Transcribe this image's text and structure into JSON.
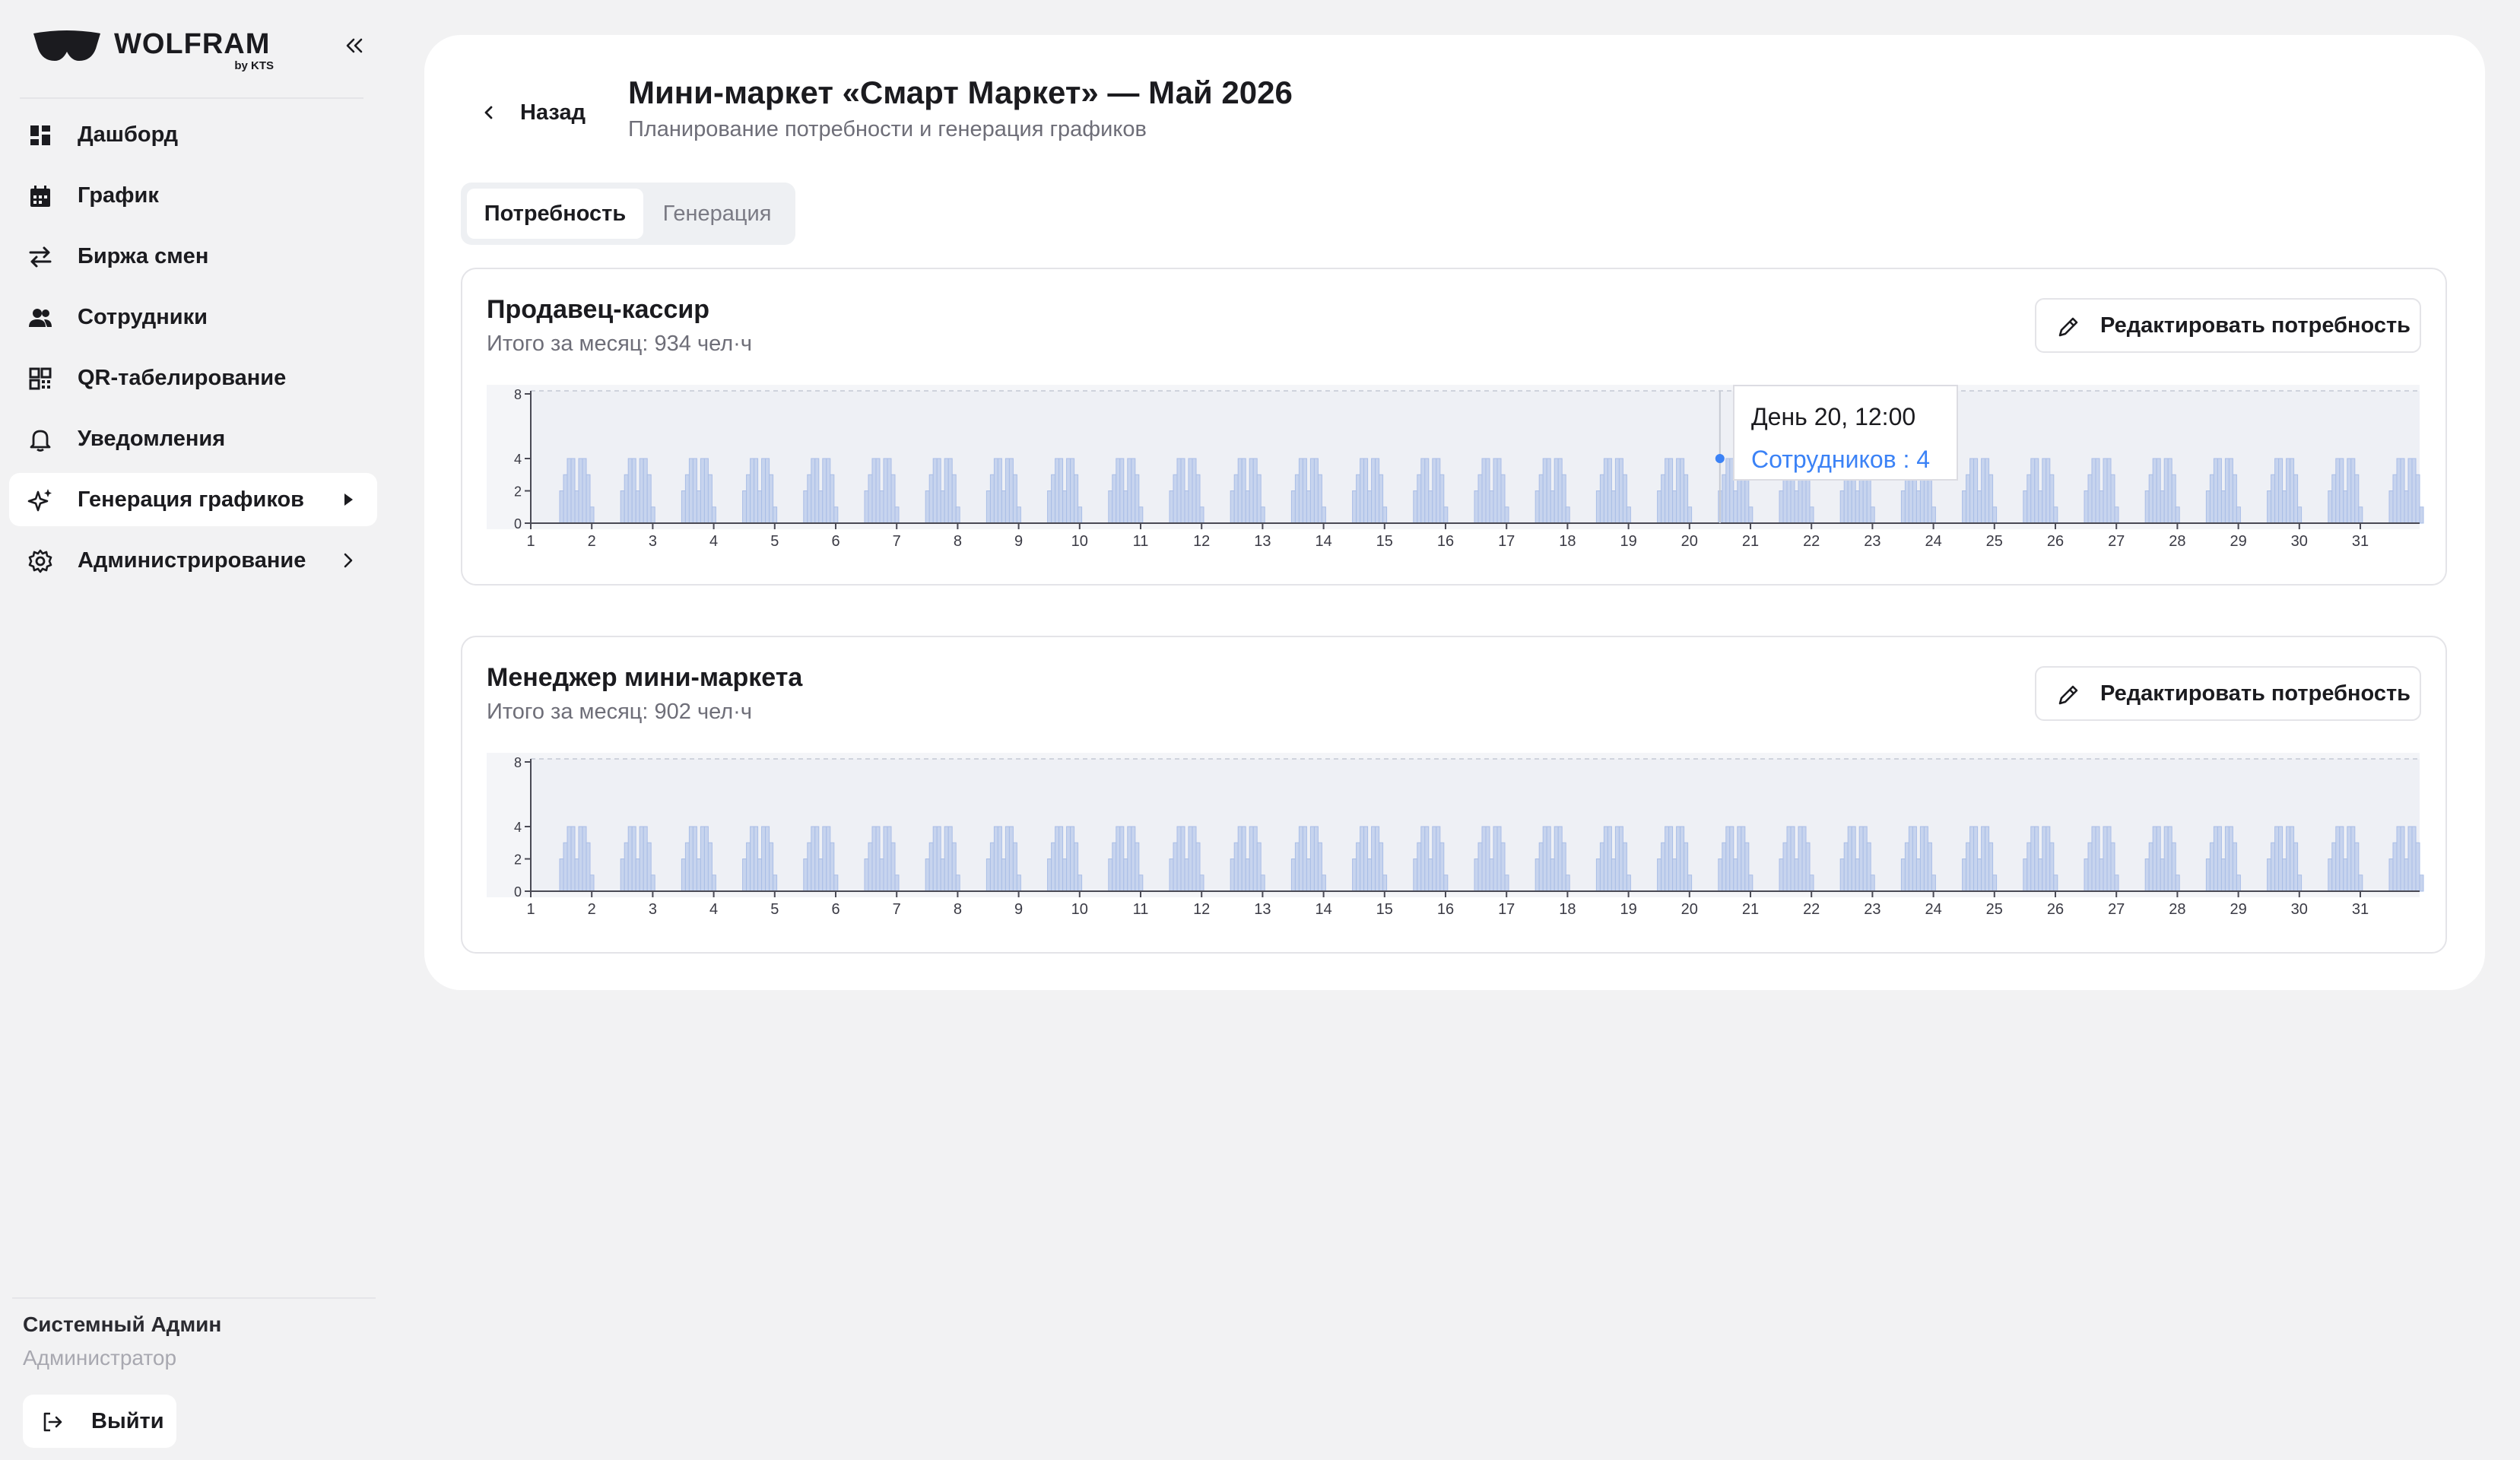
{
  "brand": {
    "name": "WOLFRAM",
    "sub": "by KTS"
  },
  "sidebar": {
    "items": [
      {
        "label": "Дашборд",
        "icon": "dashboard-icon"
      },
      {
        "label": "График",
        "icon": "calendar-icon"
      },
      {
        "label": "Биржа смен",
        "icon": "swap-icon"
      },
      {
        "label": "Сотрудники",
        "icon": "users-icon"
      },
      {
        "label": "QR-табелирование",
        "icon": "qr-icon"
      },
      {
        "label": "Уведомления",
        "icon": "bell-icon"
      },
      {
        "label": "Генерация графиков",
        "icon": "sparkle-icon",
        "active": true
      },
      {
        "label": "Администрирование",
        "icon": "gear-icon"
      }
    ],
    "user": {
      "name": "Системный Админ",
      "role": "Администратор"
    },
    "logout_label": "Выйти"
  },
  "header": {
    "back_label": "Назад",
    "title": "Мини-маркет «Смарт Маркет» — Май 2026",
    "subtitle": "Планирование потребности и генерация графиков"
  },
  "tabs": [
    {
      "label": "Потребность",
      "active": true
    },
    {
      "label": "Генерация",
      "active": false
    }
  ],
  "cards": [
    {
      "title": "Продавец-кассир",
      "total": "Итого за месяц: 934 чел·ч",
      "edit_label": "Редактировать потребность"
    },
    {
      "title": "Менеджер мини-маркета",
      "total": "Итого за месяц: 902 чел·ч",
      "edit_label": "Редактировать потребность"
    }
  ],
  "tooltip": {
    "title": "День 20, 12:00",
    "value": "Сотрудников : 4"
  },
  "chart_data": [
    {
      "type": "area",
      "x_ticks": [
        "1",
        "2",
        "3",
        "4",
        "5",
        "6",
        "7",
        "8",
        "9",
        "10",
        "11",
        "12",
        "13",
        "14",
        "15",
        "16",
        "17",
        "18",
        "19",
        "20",
        "21",
        "22",
        "23",
        "24",
        "25",
        "26",
        "27",
        "28",
        "29",
        "30",
        "31"
      ],
      "y_ticks": [
        "0",
        "2",
        "4",
        "8"
      ],
      "ylim": [
        0,
        8
      ],
      "grid": false,
      "daily_peak": [
        4,
        4,
        4,
        4,
        4,
        4,
        4,
        4,
        4,
        4,
        4,
        4,
        4,
        4,
        4,
        4,
        4,
        4,
        4,
        4,
        4,
        4,
        4,
        4,
        4,
        4,
        4,
        4,
        4,
        4,
        4
      ],
      "color": "#c7d4ee"
    },
    {
      "type": "area",
      "x_ticks": [
        "1",
        "2",
        "3",
        "4",
        "5",
        "6",
        "7",
        "8",
        "9",
        "10",
        "11",
        "12",
        "13",
        "14",
        "15",
        "16",
        "17",
        "18",
        "19",
        "20",
        "21",
        "22",
        "23",
        "24",
        "25",
        "26",
        "27",
        "28",
        "29",
        "30",
        "31"
      ],
      "y_ticks": [
        "0",
        "2",
        "4",
        "8"
      ],
      "ylim": [
        0,
        8
      ],
      "grid": false,
      "daily_peak": [
        4,
        4,
        4,
        4,
        4,
        4,
        4,
        4,
        4,
        4,
        4,
        4,
        4,
        4,
        4,
        4,
        4,
        4,
        4,
        4,
        4,
        4,
        4,
        4,
        4,
        4,
        4,
        4,
        4,
        4,
        4
      ],
      "color": "#c7d4ee"
    }
  ]
}
